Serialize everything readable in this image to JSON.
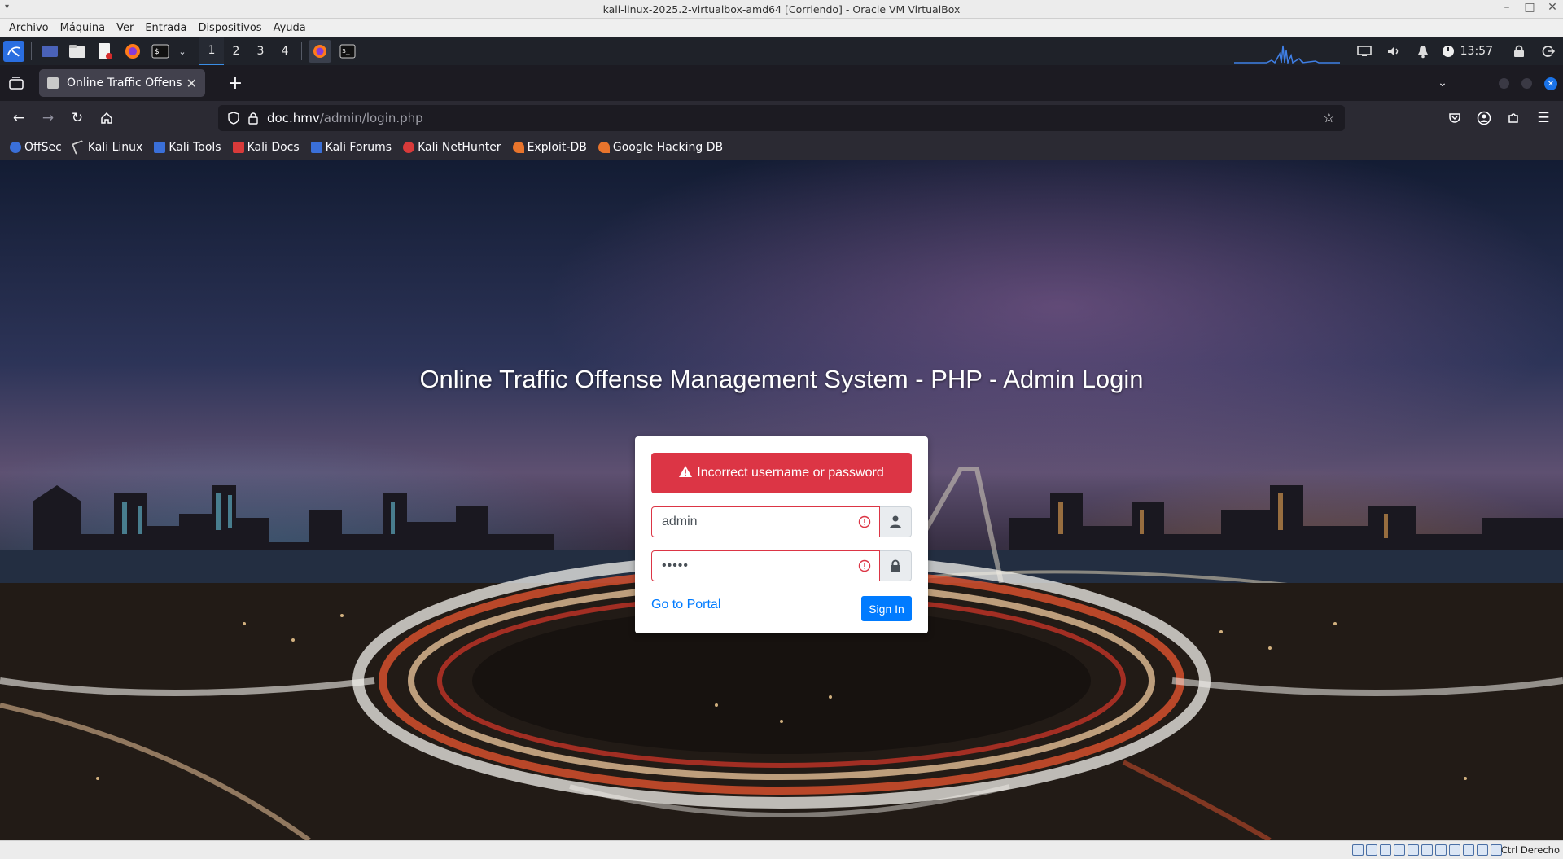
{
  "vbox": {
    "title": "kali-linux-2025.2-virtualbox-amd64 [Corriendo] - Oracle VM VirtualBox",
    "menu": [
      "Archivo",
      "Máquina",
      "Ver",
      "Entrada",
      "Dispositivos",
      "Ayuda"
    ],
    "host_key": "Ctrl Derecho"
  },
  "panel": {
    "workspaces": [
      "1",
      "2",
      "3",
      "4"
    ],
    "active_workspace": "1",
    "clock": "13:57"
  },
  "browser": {
    "tab_title": "Online Traffic Offense Ma",
    "url_host": "doc.hmv",
    "url_path": "/admin/login.php",
    "bookmarks": [
      {
        "label": "OffSec",
        "icon": "offsec-icon",
        "color": "#3a6fd8"
      },
      {
        "label": "Kali Linux",
        "icon": "kali-linux-icon",
        "color": "#cccccc"
      },
      {
        "label": "Kali Tools",
        "icon": "kali-tools-icon",
        "color": "#3a6fd8"
      },
      {
        "label": "Kali Docs",
        "icon": "kali-docs-icon",
        "color": "#d83a3a"
      },
      {
        "label": "Kali Forums",
        "icon": "kali-forums-icon",
        "color": "#3a6fd8"
      },
      {
        "label": "Kali NetHunter",
        "icon": "kali-nethunter-icon",
        "color": "#d83a3a"
      },
      {
        "label": "Exploit-DB",
        "icon": "exploit-db-icon",
        "color": "#e8742c"
      },
      {
        "label": "Google Hacking DB",
        "icon": "ghdb-icon",
        "color": "#e8742c"
      }
    ]
  },
  "page": {
    "title": "Online Traffic Offense Management System - PHP - Admin Login",
    "alert": "Incorrect username or password",
    "username_value": "admin",
    "password_value": "•••••",
    "portal_link": "Go to Portal",
    "signin_label": "Sign In"
  },
  "colors": {
    "alert": "#dc3545",
    "primary": "#007bff"
  }
}
